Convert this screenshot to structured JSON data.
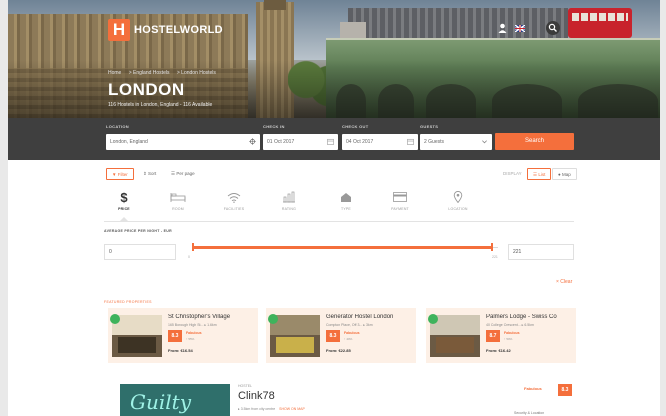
{
  "brand": {
    "logo_letter": "H",
    "name": "HOSTELWORLD",
    "accent": "#f46f3c"
  },
  "header_icons": [
    "user-icon",
    "flag-icon",
    "search-icon"
  ],
  "hero": {
    "breadcrumb": [
      "Home",
      "> England Hostels",
      "> London Hostels"
    ],
    "city": "LONDON",
    "subtitle": "116 Hostels in London, England - 116 Available"
  },
  "search": {
    "location_label": "LOCATION",
    "location_value": "London, England",
    "checkin_label": "CHECK IN",
    "checkin_value": "01 Oct 2017",
    "checkout_label": "CHECK OUT",
    "checkout_value": "04 Oct 2017",
    "guests_label": "GUESTS",
    "guests_value": "2 Guests",
    "button": "Search"
  },
  "toolbar": {
    "filter": "Filter",
    "sort": "Sort",
    "per_page": "Per page",
    "display": "DISPLAY",
    "list": "List",
    "map": "Map"
  },
  "facilities": [
    {
      "label": "PRICE",
      "icon": "dollar-icon"
    },
    {
      "label": "ROOM",
      "icon": "bed-icon"
    },
    {
      "label": "FACILITIES",
      "icon": "wifi-icon"
    },
    {
      "label": "RATING",
      "icon": "chart-icon"
    },
    {
      "label": "TYPE",
      "icon": "home-icon"
    },
    {
      "label": "PAYMENT",
      "icon": "card-icon"
    },
    {
      "label": "LOCATION",
      "icon": "pin-icon"
    }
  ],
  "price_filter": {
    "title": "AVERAGE PRICE PER NIGHT - EUR",
    "min_value": "0",
    "max_value": "221",
    "slider_min_label": "0",
    "slider_max_label": "221",
    "clear": "× Clear"
  },
  "featured": {
    "title": "FEATURED PROPERTIES",
    "cards": [
      {
        "name": "St Christopher's Village",
        "addr": "165 Borough High St... ▸ 1.6km",
        "score": "8.3",
        "rating": "Fabulous",
        "pct": "↑ 55%",
        "from": "From: €16.54"
      },
      {
        "name": "Generator Hostel London",
        "addr": "Compton Place, Off 3... ▸ 3km",
        "score": "8.3",
        "rating": "Fabulous",
        "pct": "↑ 40%",
        "from": "From: €22.85"
      },
      {
        "name": "Palmers Lodge - Swiss Co",
        "addr": "40 College Crescent... ▸ 6.5km",
        "score": "8.7",
        "rating": "Fabulous",
        "pct": "↑ 50%",
        "from": "From: €16.42"
      }
    ]
  },
  "listing": {
    "type": "HOSTEL",
    "name": "Clink78",
    "distance": "▸ 3.5km from city centre",
    "map_link": "SHOW ON MAP",
    "rating": "Fabulous",
    "score": "8.3",
    "extra": "Security & Location"
  },
  "image_text": {
    "listing_neon": "Guilty"
  }
}
